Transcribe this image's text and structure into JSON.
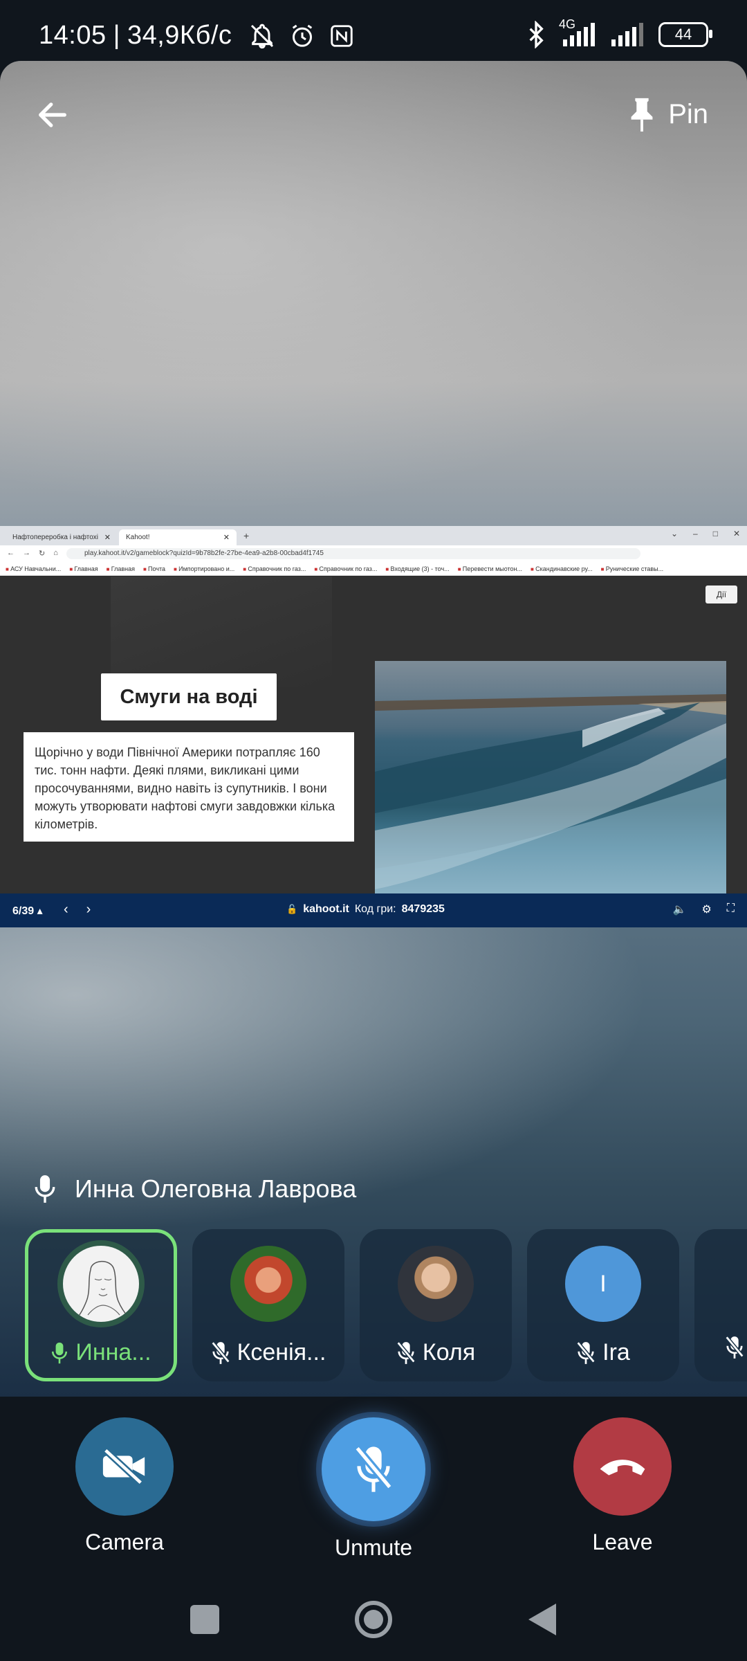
{
  "status_bar": {
    "time": "14:05",
    "network_speed": "34,9Кб/с",
    "network_type": "4G",
    "battery": "44"
  },
  "header": {
    "back_icon": "arrow-left-icon",
    "pin_label": "Pin"
  },
  "shared_screen": {
    "browser": {
      "tabs": [
        {
          "title": "Нафтопереробка і нафтохімія",
          "active": false
        },
        {
          "title": "Kahoot!",
          "active": true
        }
      ],
      "url": "play.kahoot.it/v2/gameblock?quizId=9b78b2fe-27be-4ea9-a2b8-00cbad4f1745",
      "bookmarks": [
        "АСУ Навчальни...",
        "Главная",
        "Главная",
        "Почта",
        "Импортировано и...",
        "Справочник по газ...",
        "Справочник по газ...",
        "Входящие (3) - точ...",
        "Перевести мыотон...",
        "Скандинавские ру...",
        "Рунические ставы..."
      ]
    },
    "slide": {
      "actions_label": "Дії",
      "title": "Смуги на воді",
      "body": "Щорічно у води Північної Америки потрапляє 160 тис. тонн нафти. Деякі плями, викликані цими просочуваннями, видно навіть із супутників. І вони можуть утворювати нафтові смуги завдовжки кілька кілометрів."
    },
    "kahoot_bar": {
      "progress": "6/39 ▴",
      "site": "kahoot.it",
      "code_label": "Код гри:",
      "code_value": "8479235"
    }
  },
  "speaker": {
    "name": "Инна Олеговна Лаврова"
  },
  "participants": [
    {
      "name": "Инна...",
      "muted": false,
      "speaking": true
    },
    {
      "name": "Ксенія...",
      "muted": true,
      "speaking": false
    },
    {
      "name": "Коля",
      "muted": true,
      "speaking": false
    },
    {
      "name": "Ira",
      "muted": true,
      "speaking": false,
      "initial": "I"
    }
  ],
  "controls": {
    "camera_label": "Camera",
    "unmute_label": "Unmute",
    "leave_label": "Leave"
  },
  "colors": {
    "active_speaker": "#7ae17a",
    "camera_button": "#2a6b93",
    "unmute_button": "#4e9ee3",
    "leave_button": "#b23b44",
    "kahoot_bar": "#0a2a57"
  }
}
